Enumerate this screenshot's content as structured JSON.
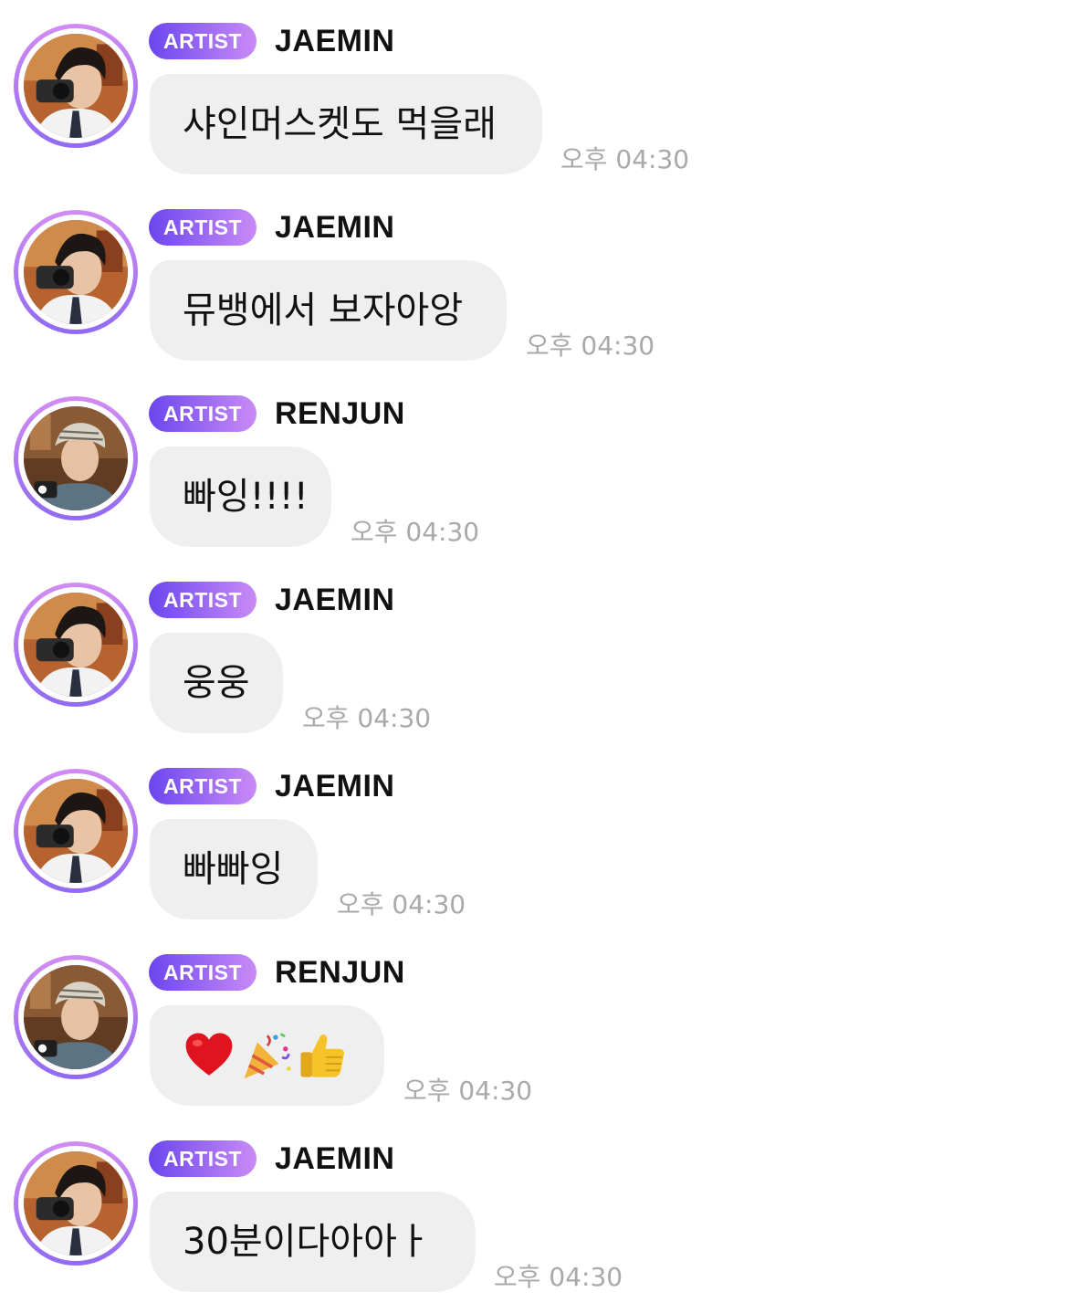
{
  "badge_label": "ARTIST",
  "messages": [
    {
      "sender": "JAEMIN",
      "avatar": "jaemin-avatar",
      "text": "샤인머스켓도 먹을래",
      "time": "오후 04:30"
    },
    {
      "sender": "JAEMIN",
      "avatar": "jaemin-avatar",
      "text": "뮤뱅에서 보자아앙",
      "time": "오후 04:30"
    },
    {
      "sender": "RENJUN",
      "avatar": "renjun-avatar",
      "text": "빠잉!!!!",
      "time": "오후 04:30"
    },
    {
      "sender": "JAEMIN",
      "avatar": "jaemin-avatar",
      "text": "웅웅",
      "time": "오후 04:30"
    },
    {
      "sender": "JAEMIN",
      "avatar": "jaemin-avatar",
      "text": "빠빠잉",
      "time": "오후 04:30"
    },
    {
      "sender": "RENJUN",
      "avatar": "renjun-avatar",
      "text": "",
      "emojis": [
        "heart-emoji",
        "party-popper-emoji",
        "thumbs-up-emoji"
      ],
      "time": "오후 04:30"
    },
    {
      "sender": "JAEMIN",
      "avatar": "jaemin-avatar",
      "text": "30분이다아아ㅏ",
      "time": "오후 04:30"
    }
  ],
  "colors": {
    "bubble": "#efefef",
    "badge_start": "#6b46f0",
    "badge_end": "#c98bf5",
    "ring_top": "#d28cf2",
    "ring_bottom": "#8f6bf2",
    "time": "#a9a9a9",
    "name": "#111111"
  }
}
